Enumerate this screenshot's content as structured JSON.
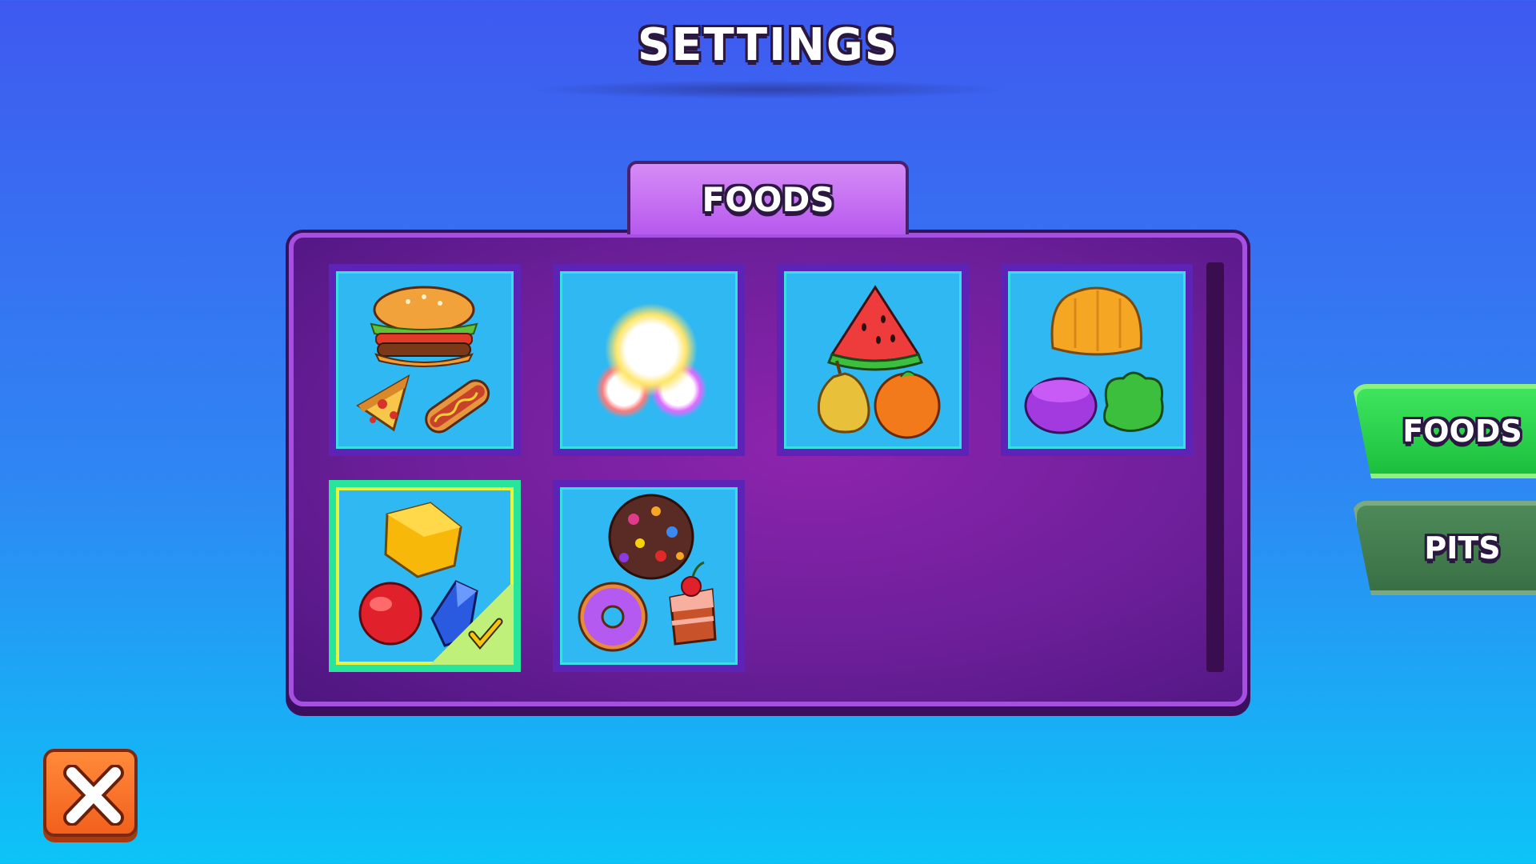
{
  "header": {
    "title": "SETTINGS"
  },
  "panel": {
    "tab_label": "FOODS",
    "tiles": [
      {
        "name": "fastfood",
        "icon": "burger-pizza-hotdog-icon",
        "selected": false
      },
      {
        "name": "glow",
        "icon": "glowing-orbs-icon",
        "selected": false
      },
      {
        "name": "fruits",
        "icon": "watermelon-pear-orange-icon",
        "selected": false
      },
      {
        "name": "jelly",
        "icon": "jelly-icon",
        "selected": false
      },
      {
        "name": "gems",
        "icon": "gems-icon",
        "selected": true
      },
      {
        "name": "sweets",
        "icon": "cookie-donut-cake-icon",
        "selected": false
      }
    ]
  },
  "side_menu": {
    "foods_label": "FOODS",
    "pits_label": "PITS"
  },
  "colors": {
    "bg_top": "#3f59f0",
    "bg_bottom": "#0cc4f7",
    "panel": "#7a1fa2",
    "tile": "#2fb8f2",
    "foods_button": "#2bd14c",
    "pits_button": "#457c50",
    "close_button": "#f26d25"
  },
  "close_button": {
    "icon": "close-x-icon"
  }
}
